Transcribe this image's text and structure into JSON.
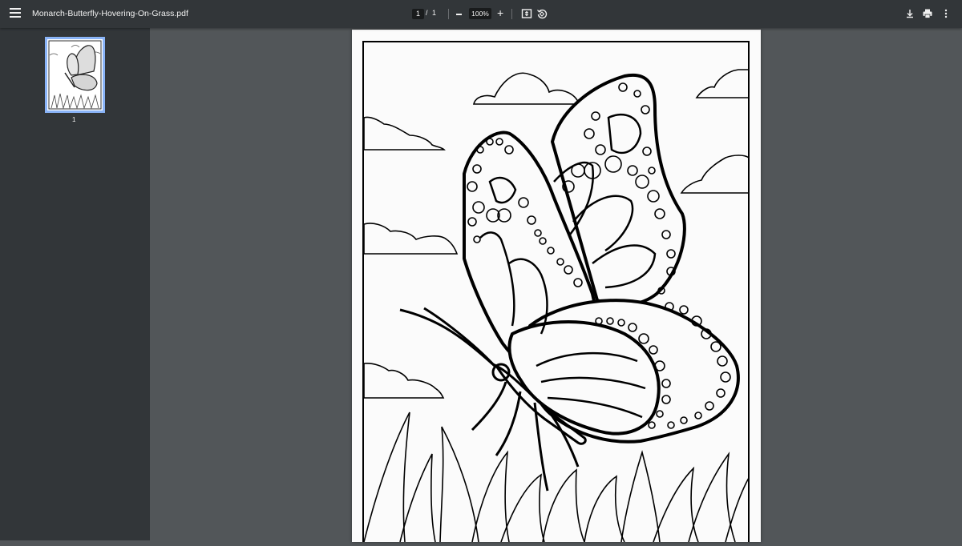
{
  "toolbar": {
    "title": "Monarch-Butterfly-Hovering-On-Grass.pdf",
    "current_page": "1",
    "page_separator": "/",
    "total_pages": "1",
    "zoom": "100%"
  },
  "sidebar": {
    "thumbnails": [
      {
        "label": "1",
        "selected": true
      }
    ]
  },
  "colors": {
    "toolbar_bg": "#323639",
    "viewer_bg": "#525659",
    "thumb_highlight": "#8ab4f8"
  },
  "icons": [
    "menu-icon",
    "minus-icon",
    "plus-icon",
    "fit-page-icon",
    "rotate-icon",
    "download-icon",
    "print-icon",
    "more-vert-icon"
  ]
}
